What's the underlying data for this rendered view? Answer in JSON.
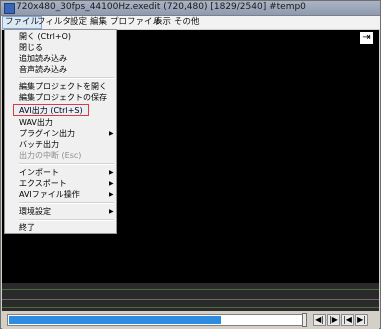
{
  "window": {
    "title": "720x480_30fps_44100Hz.exedit  (720,480)  [1829/2540]  #temp0"
  },
  "menubar": {
    "items": [
      "ファイル",
      "フィルタ",
      "設定",
      "編集",
      "プロファイル",
      "表示",
      "その他"
    ]
  },
  "file_menu": {
    "items": [
      {
        "label": "開く (Ctrl+O)"
      },
      {
        "label": "閉じる"
      },
      {
        "label": "追加読み込み"
      },
      {
        "label": "音声読み込み"
      },
      {
        "label": "編集プロジェクトを開く"
      },
      {
        "label": "編集プロジェクトの保存"
      },
      {
        "label": "AVI出力 (Ctrl+S)",
        "highlighted": true
      },
      {
        "label": "WAV出力"
      },
      {
        "label": "プラグイン出力",
        "submenu": true
      },
      {
        "label": "バッチ出力"
      },
      {
        "label": "出力の中断 (Esc)",
        "disabled": true
      },
      {
        "label": "インポート",
        "submenu": true
      },
      {
        "label": "エクスポート",
        "submenu": true
      },
      {
        "label": "AVIファイル操作",
        "submenu": true
      },
      {
        "label": "環境設定",
        "submenu": true
      },
      {
        "label": "終了"
      }
    ]
  },
  "playback": {
    "position_fraction": 0.72
  },
  "colors": {
    "highlight_border": "#e03a3a",
    "progress_fill": "#2d8ce0"
  }
}
